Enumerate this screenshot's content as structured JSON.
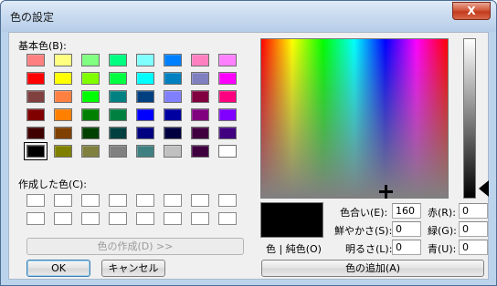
{
  "window": {
    "title": "色の設定",
    "close_label": "X"
  },
  "basic_colors": {
    "label": "基本色(B):",
    "swatches": [
      [
        "#ff8080",
        "#ffff80",
        "#80ff80",
        "#00ff80",
        "#80ffff",
        "#0080ff",
        "#ff80c0",
        "#ff80ff"
      ],
      [
        "#ff0000",
        "#ffff00",
        "#80ff00",
        "#00ff40",
        "#00ffff",
        "#0080c0",
        "#8080c0",
        "#ff00ff"
      ],
      [
        "#804040",
        "#ff8040",
        "#00ff00",
        "#008080",
        "#004080",
        "#8080ff",
        "#800040",
        "#ff0080"
      ],
      [
        "#800000",
        "#ff8000",
        "#008000",
        "#008040",
        "#0000ff",
        "#0000a0",
        "#800080",
        "#8000ff"
      ],
      [
        "#400000",
        "#804000",
        "#004000",
        "#004040",
        "#000080",
        "#000040",
        "#400040",
        "#400080"
      ],
      [
        "#000000",
        "#808000",
        "#808040",
        "#808080",
        "#408080",
        "#c0c0c0",
        "#400040",
        "#ffffff"
      ]
    ],
    "selected_index": [
      5,
      0
    ]
  },
  "custom_colors": {
    "label": "作成した色(C):",
    "rows": 2,
    "cols": 8
  },
  "define_button": {
    "label": "色の作成(D) >>"
  },
  "ok_button": {
    "label": "OK"
  },
  "cancel_button": {
    "label": "キャンセル"
  },
  "preview_label": "色 | 純色(O)",
  "hue": {
    "label": "色合い(E):",
    "value": "160"
  },
  "sat": {
    "label": "鮮やかさ(S):",
    "value": "0"
  },
  "lum": {
    "label": "明るさ(L):",
    "value": "0"
  },
  "red": {
    "label": "赤(R):",
    "value": "0"
  },
  "green": {
    "label": "緑(G):",
    "value": "0"
  },
  "blue": {
    "label": "青(U):",
    "value": "0"
  },
  "add_custom_button": {
    "label": "色の追加(A)"
  }
}
